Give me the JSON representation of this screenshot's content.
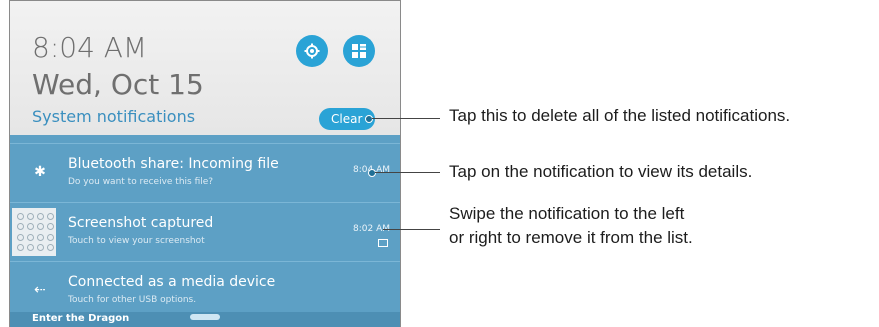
{
  "header": {
    "time": "8:04 AM",
    "date": "Wed, Oct 15",
    "system_notifications": "System notifications",
    "clear_label": "Clear"
  },
  "notifications": [
    {
      "title": "Bluetooth share: Incoming file",
      "subtitle": "Do you want to receive this file?",
      "time": "8:04 AM",
      "icon": "bluetooth-icon"
    },
    {
      "title": "Screenshot captured",
      "subtitle": "Touch to view your screenshot",
      "time": "8:02 AM",
      "icon": "screenshot-thumbnail"
    },
    {
      "title": "Connected as a media device",
      "subtitle": "Touch for other USB options.",
      "time": "",
      "icon": "usb-icon"
    }
  ],
  "bottom_bar": {
    "label": "Enter the Dragon"
  },
  "callouts": [
    "Tap this to delete all of the listed notifications.",
    "Tap on the notification to view its details.",
    "Swipe the notification to the left",
    "or right to remove it from the list."
  ],
  "colors": {
    "accent": "#2aa3d6",
    "panel": "#5da0c5"
  }
}
